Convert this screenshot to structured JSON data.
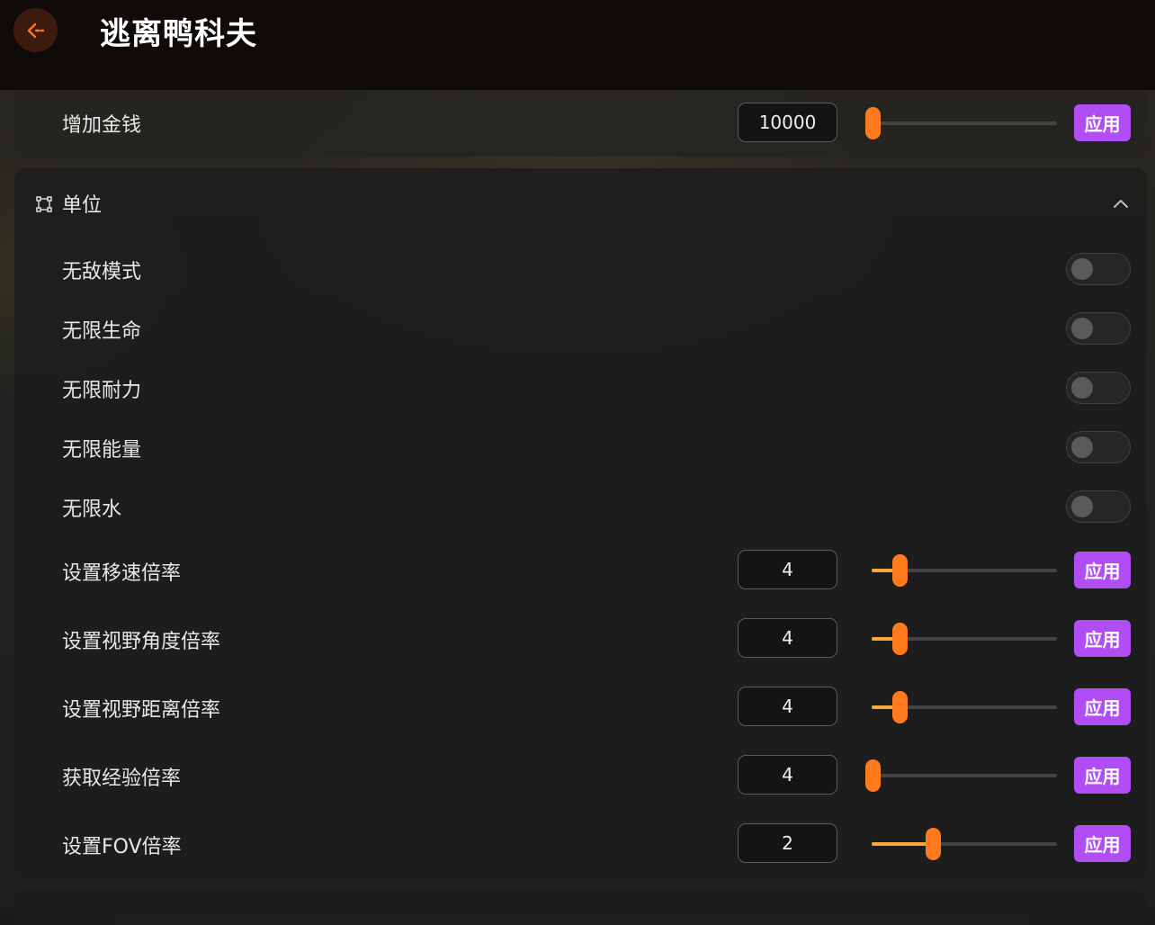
{
  "app": {
    "title": "逃离鸭科夫"
  },
  "top_row": {
    "label": "增加金钱",
    "value": "10000",
    "slider_fraction": 0.0,
    "apply_label": "应用"
  },
  "section": {
    "title": "单位"
  },
  "toggles": [
    {
      "label": "无敌模式",
      "on": false
    },
    {
      "label": "无限生命",
      "on": false
    },
    {
      "label": "无限耐力",
      "on": false
    },
    {
      "label": "无限能量",
      "on": false
    },
    {
      "label": "无限水",
      "on": false
    }
  ],
  "slider_rows": [
    {
      "label": "设置移速倍率",
      "value": "4",
      "slider_fraction": 0.15,
      "apply_label": "应用"
    },
    {
      "label": "设置视野角度倍率",
      "value": "4",
      "slider_fraction": 0.15,
      "apply_label": "应用"
    },
    {
      "label": "设置视野距离倍率",
      "value": "4",
      "slider_fraction": 0.15,
      "apply_label": "应用"
    },
    {
      "label": "获取经验倍率",
      "value": "4",
      "slider_fraction": 0.0,
      "apply_label": "应用"
    },
    {
      "label": "设置FOV倍率",
      "value": "2",
      "slider_fraction": 0.33,
      "apply_label": "应用"
    }
  ],
  "colors": {
    "accent": "#ff7a1c",
    "apply": "#b14df4",
    "fill": "#ffa63a"
  },
  "icons": {
    "back": "arrow-left-icon",
    "section": "nodes-icon",
    "collapse": "chevron-up-icon"
  }
}
